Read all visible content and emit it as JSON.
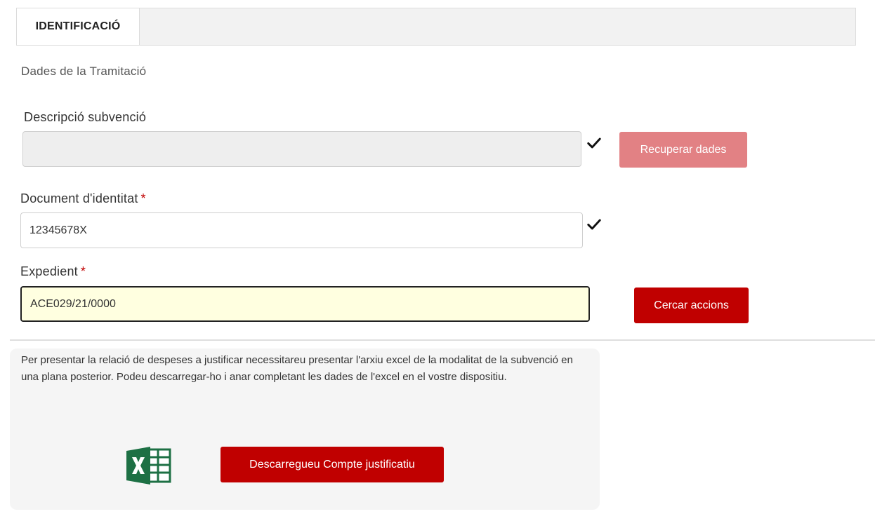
{
  "tabs": {
    "active_label": "IDENTIFICACIÓ"
  },
  "section": {
    "title": "Dades de la Tramitació"
  },
  "form": {
    "description": {
      "label": "Descripció subvenció",
      "value": ""
    },
    "document": {
      "label": "Document d'identitat",
      "required_mark": "*",
      "value": "12345678X"
    },
    "expedient": {
      "label": "Expedient",
      "required_mark": "*",
      "value": "ACE029/21/0000"
    }
  },
  "buttons": {
    "recover": "Recuperar dades",
    "search": "Cercar accions",
    "download": "Descarregueu Compte justificatiu"
  },
  "info": {
    "text": "Per presentar la relació de despeses a justificar necessitareu presentar l'arxiu excel de la modalitat de la subvenció en una plana posterior. Podeu descarregar-ho i anar completant les dades de l'excel en el vostre dispositiu."
  },
  "icons": {
    "check": "check-icon",
    "excel": "excel-icon"
  },
  "colors": {
    "primary": "#c00000",
    "primary_disabled": "#e28184",
    "excel_green": "#1d7044",
    "focused_field_bg": "#ffffe0"
  }
}
